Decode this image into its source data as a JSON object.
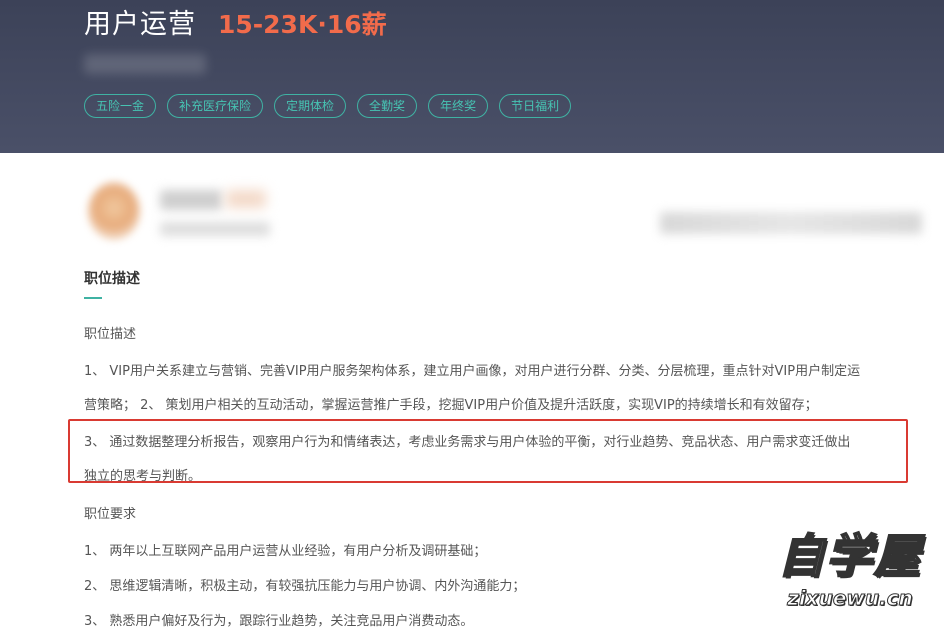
{
  "job": {
    "title": "用户运营",
    "salary": "15-23K·16薪"
  },
  "benefits": [
    "五险一金",
    "补充医疗保险",
    "定期体检",
    "全勤奖",
    "年终奖",
    "节日福利"
  ],
  "section": {
    "heading": "职位描述"
  },
  "description": {
    "label": "职位描述",
    "lines": [
      "1、 VIP用户关系建立与营销、完善VIP用户服务架构体系，建立用户画像，对用户进行分群、分类、分层梳理，重点针对VIP用户制定运",
      "营策略； 2、 策划用户相关的互动活动，掌握运营推广手段，挖掘VIP用户价值及提升活跃度，实现VIP的持续增长和有效留存；",
      "3、 通过数据整理分析报告，观察用户行为和情绪表达，考虑业务需求与用户体验的平衡，对行业趋势、竞品状态、用户需求变迁做出",
      "独立的思考与判断。"
    ]
  },
  "requirements": {
    "label": "职位要求",
    "lines": [
      "1、 两年以上互联网产品用户运营从业经验，有用户分析及调研基础；",
      "2、 思维逻辑清晰，积极主动，有较强抗压能力与用户协调、内外沟通能力；",
      "3、 熟悉用户偏好及行为，跟踪行业趋势，关注竞品用户消费动态。"
    ]
  },
  "watermark": {
    "cn": "自学屋",
    "en": "zixuewu.cn"
  },
  "colors": {
    "header_bg": "#3c4258",
    "salary": "#f26b4b",
    "tag_accent": "#3fb2a3",
    "highlight_border": "#d93a32"
  }
}
